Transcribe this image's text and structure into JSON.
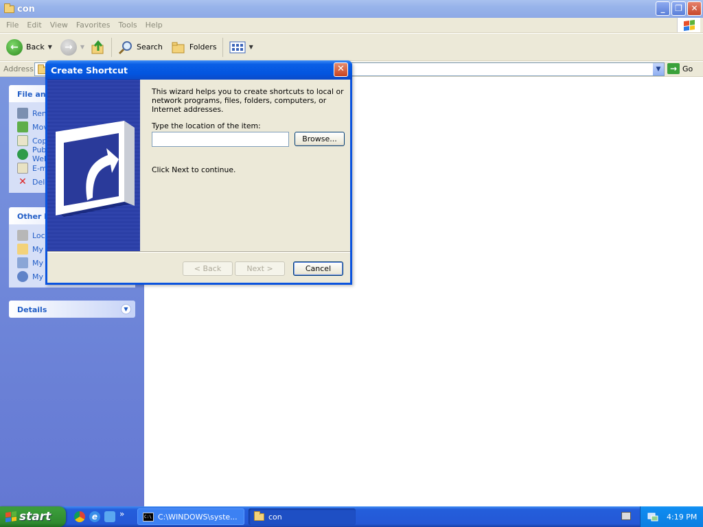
{
  "window": {
    "title": "con",
    "minimize": "_",
    "maximize": "❐",
    "close": "✕"
  },
  "menu": [
    "File",
    "Edit",
    "View",
    "Favorites",
    "Tools",
    "Help"
  ],
  "toolbar": {
    "back_label": "Back",
    "search_label": "Search",
    "folders_label": "Folders"
  },
  "address": {
    "label": "Address",
    "value": "",
    "go_label": "Go"
  },
  "left_pane": {
    "file_tasks_title": "File and Folder Tasks",
    "file_tasks": [
      "Rename this file",
      "Move this file",
      "Copy this file",
      "Publish this file to the Web",
      "E-mail this file",
      "Delete this file"
    ],
    "other_places_title": "Other Places",
    "other_places": [
      "Local Disk (C:)",
      "My Documents",
      "My Computer",
      "My Network Places"
    ],
    "details_title": "Details"
  },
  "dialog": {
    "title": "Create Shortcut",
    "close": "✕",
    "intro": "This wizard helps you to create shortcuts to local or network programs, files, folders, computers, or Internet addresses.",
    "location_label": "Type the location of the item:",
    "location_value": "",
    "browse_label": "Browse...",
    "next_note": "Click Next to continue.",
    "back_label": "< Back",
    "next_label": "Next >",
    "cancel_label": "Cancel"
  },
  "taskbar": {
    "start_label": "start",
    "more": "»",
    "tasks": [
      "C:\\WINDOWS\\syste...",
      "con"
    ],
    "cmd_icon_text": "C:\\",
    "clock": "4:19 PM"
  },
  "colors": {
    "xp_blue": "#0355df",
    "taskbar_blue": "#245edb",
    "start_green": "#3a9b3a",
    "pane_blue": "#6c86d9",
    "link_blue": "#215dc6"
  }
}
